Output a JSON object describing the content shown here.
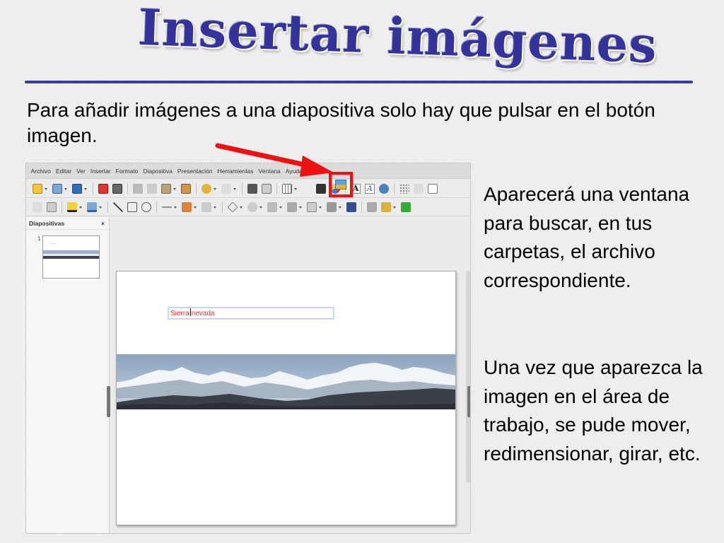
{
  "slide": {
    "title": "Insertar imágenes",
    "intro": "Para añadir imágenes a una diapositiva solo hay que pulsar en el botón imagen.",
    "paragraph_1": "Aparecerá una ventana para buscar, en tus carpetas, el archivo correspondiente.",
    "paragraph_2": "Una vez que aparezca la imagen en el área de trabajo, se pude mover, redimensionar, girar, etc."
  },
  "app": {
    "menu": [
      "Archivo",
      "Editar",
      "Ver",
      "Insertar",
      "Formato",
      "Diapositiva",
      "Presentación",
      "Herramientas",
      "Ventana",
      "Ayuda"
    ],
    "panel_title": "Diapositivas",
    "panel_close": "×",
    "slide_number": "1",
    "textbox_text_before": "Sierra",
    "textbox_text_after": "nevada"
  },
  "colors": {
    "title": "#33339a",
    "rule": "#3b3ba0",
    "highlight": "#ee1111",
    "textbox_text": "#dd3333"
  },
  "icons": [
    "new-icon",
    "open-icon",
    "save-icon",
    "pdf-icon",
    "print-icon",
    "cut-icon",
    "copy-icon",
    "paste-icon",
    "clone-format-icon",
    "undo-icon",
    "spellcheck-icon",
    "table-icon",
    "image-icon",
    "movie-icon",
    "chart-icon",
    "text-icon",
    "fontwork-icon"
  ]
}
